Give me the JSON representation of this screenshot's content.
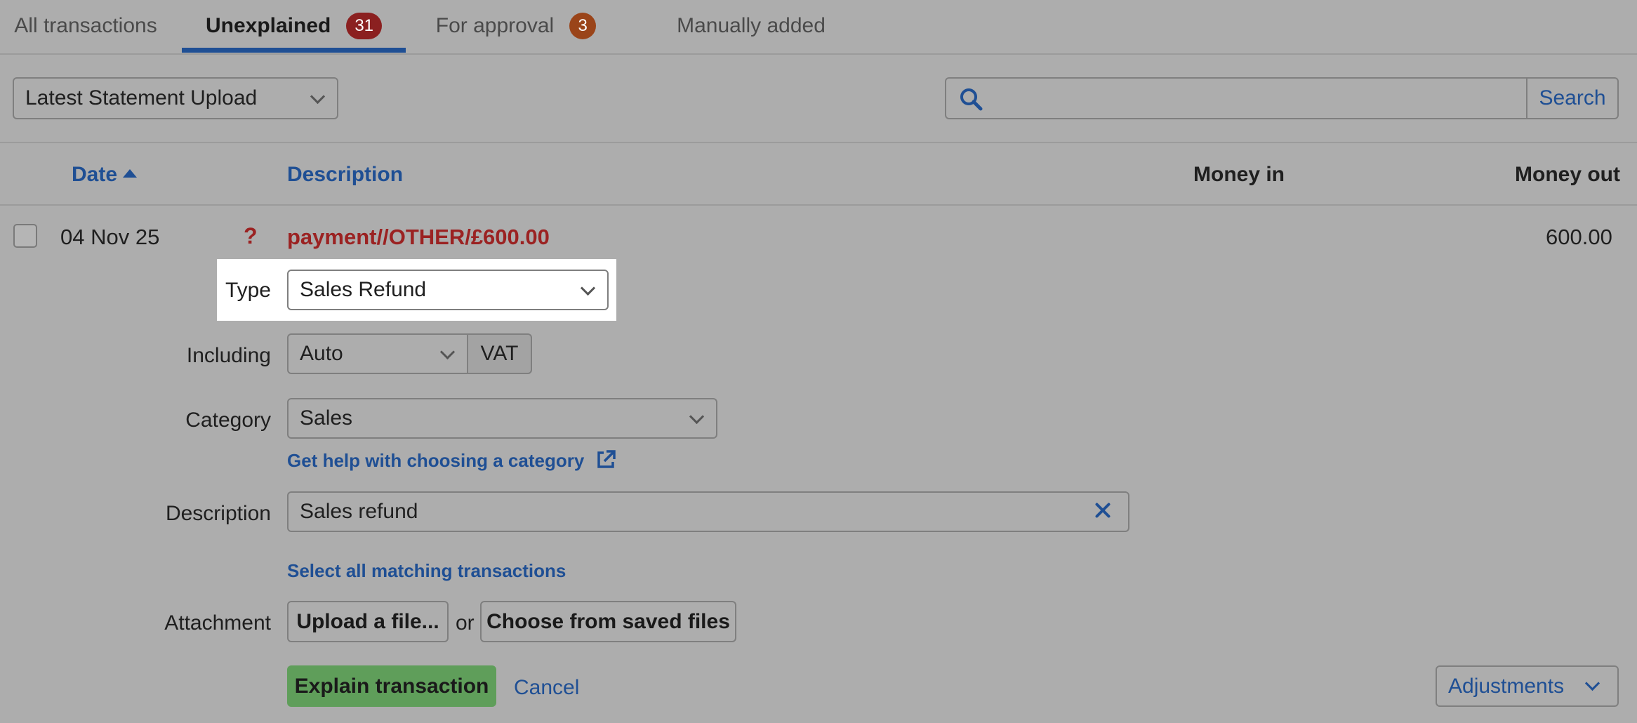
{
  "tabs": [
    {
      "label": "All transactions"
    },
    {
      "label": "Unexplained",
      "badge": "31"
    },
    {
      "label": "For approval",
      "badge": "3"
    },
    {
      "label": "Manually added"
    }
  ],
  "colors": {
    "accent": "#1f4f94",
    "badge_unexplained": "#8b2020",
    "badge_approval": "#9a4419",
    "description_red": "#9b2222",
    "primary_button": "#5f9e5a",
    "background": "#adadad"
  },
  "filter": {
    "statement_select": "Latest Statement Upload",
    "search_placeholder": "",
    "search_button": "Search"
  },
  "columns": {
    "date": "Date",
    "description": "Description",
    "money_in": "Money in",
    "money_out": "Money out"
  },
  "transaction": {
    "date": "04 Nov 25",
    "status_icon": "?",
    "description": "payment//OTHER/£600.00",
    "money_out": "600.00"
  },
  "form": {
    "type_label": "Type",
    "type_value": "Sales Refund",
    "including_label": "Including",
    "including_value": "Auto",
    "vat_label": "VAT",
    "category_label": "Category",
    "category_value": "Sales",
    "category_help_link": "Get help with choosing a category",
    "description_label": "Description",
    "description_value": "Sales refund",
    "select_matching_link": "Select all matching transactions",
    "attachment_label": "Attachment",
    "upload_button": "Upload a file...",
    "or_text": "or",
    "saved_files_button": "Choose from saved files",
    "explain_button": "Explain transaction",
    "cancel_link": "Cancel",
    "adjustments_button": "Adjustments"
  }
}
